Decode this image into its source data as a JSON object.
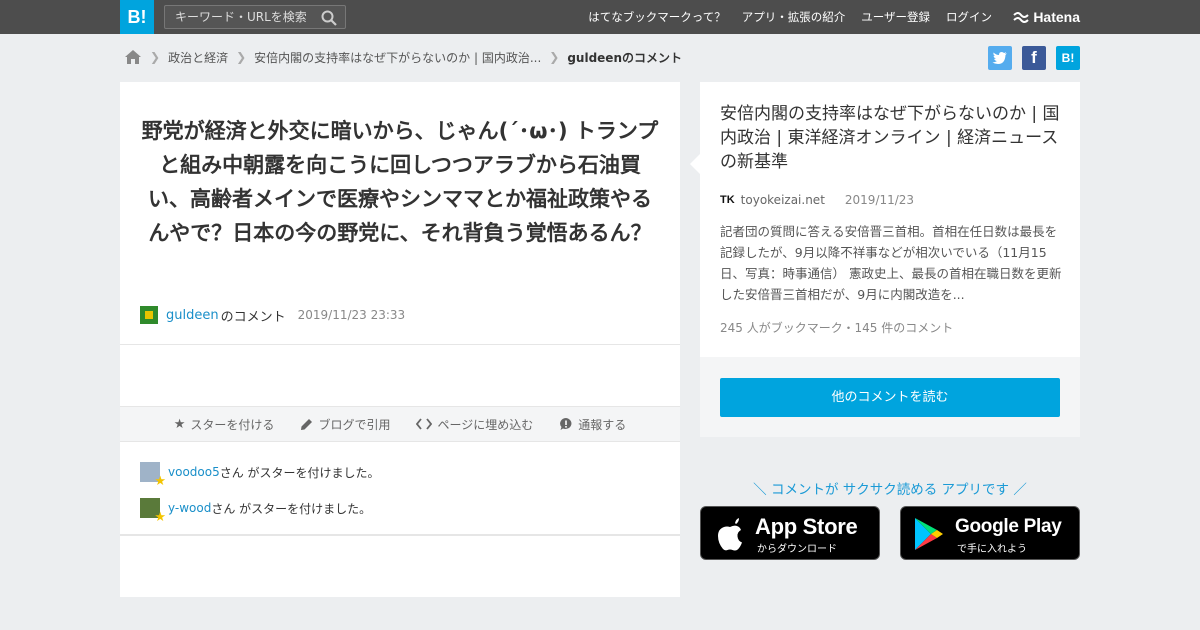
{
  "header": {
    "logo": "B!",
    "search_placeholder": "キーワード・URLを検索",
    "nav": [
      "はてなブックマークって？",
      "アプリ・拡張の紹介",
      "ユーザー登録",
      "ログイン"
    ],
    "brand": "Hatena"
  },
  "breadcrumb": {
    "items": [
      "政治と経済",
      "安倍内閣の支持率はなぜ下がらないのか | 国内政治..."
    ],
    "current": "guldeenのコメント"
  },
  "share": {
    "twitter": "t",
    "facebook": "f",
    "hatena": "B!"
  },
  "comment": {
    "text": "野党が経済と外交に暗いから、じゃん(´･ω･) トランプと組み中朝露を向こうに回しつつアラブから石油買い、高齢者メインで医療やシンママとか福祉政策やるんやで？日本の今の野党に、それ背負う覚悟あるん？",
    "user": "guldeen",
    "user_suffix": "のコメント",
    "datetime": "2019/11/23 23:33"
  },
  "actions": {
    "star": "スターを付ける",
    "blog": "ブログで引用",
    "embed": "ページに埋め込む",
    "report": "通報する"
  },
  "stars": [
    {
      "user": "voodoo5",
      "text": "さん がスターを付けました。"
    },
    {
      "user": "y-wood",
      "text": "さん がスターを付けました。"
    }
  ],
  "article": {
    "title": "安倍内閣の支持率はなぜ下がらないのか | 国内政治 | 東洋経済オンライン | 経済ニュースの新基準",
    "site_logo": "TK",
    "site": "toyokeizai.net",
    "date": "2019/11/23",
    "summary": "記者団の質問に答える安倍晋三首相。首相在任日数は最長を記録したが、9月以降不祥事などが相次いでいる（11月15日、写真：時事通信） 憲政史上、最長の首相在職日数を更新した安倍晋三首相だが、9月に内閣改造を...",
    "counts": "245 人がブックマーク・145 件のコメント",
    "read_button": "他のコメントを読む"
  },
  "promo": {
    "text": "＼ コメントが サクサク読める アプリです ／",
    "appstore_big": "App Store",
    "appstore_small": "からダウンロード",
    "googleplay_big": "Google Play",
    "googleplay_small": "で手に入れよう"
  },
  "colors": {
    "accent": "#00a4de",
    "link": "#1a8fc9",
    "twitter": "#55acee",
    "facebook": "#3b5998"
  }
}
